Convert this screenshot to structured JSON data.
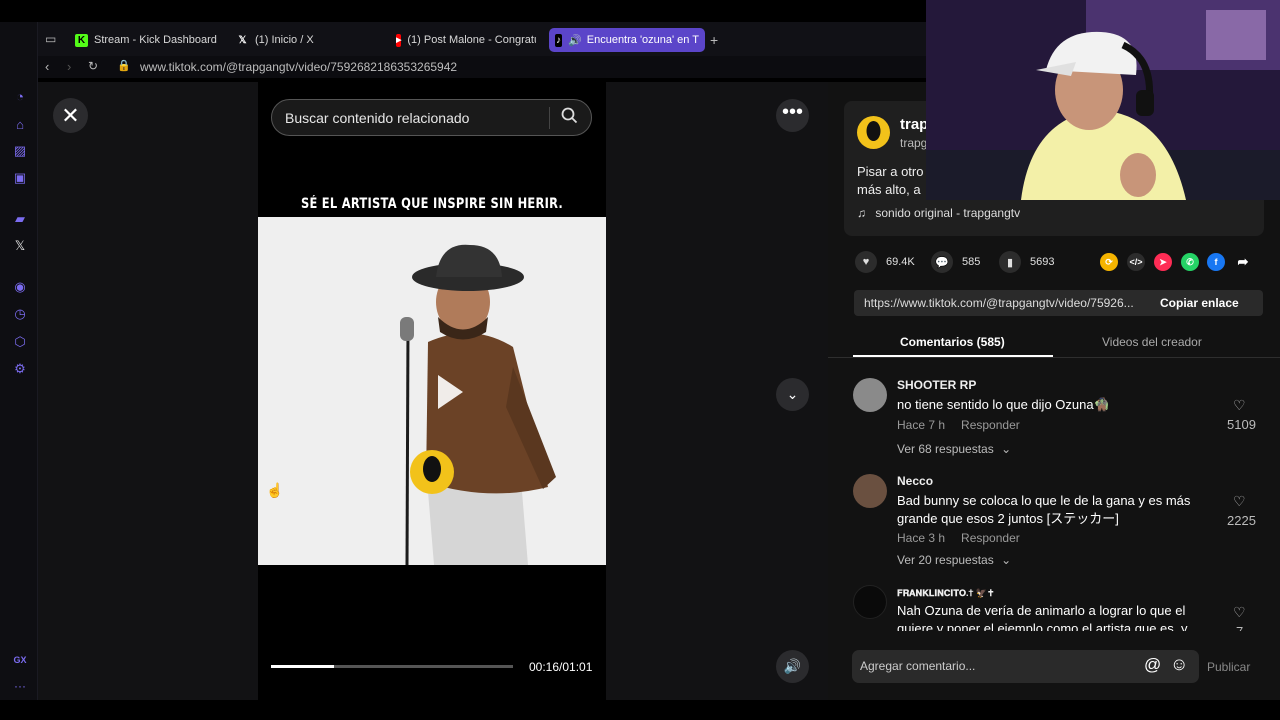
{
  "browser": {
    "tabs": [
      {
        "label": "Stream - Kick Dashboard",
        "icon": "kick-icon"
      },
      {
        "label": "(1) Inicio / X",
        "icon": "x-icon"
      },
      {
        "label": "(1) Post Malone - Congratu",
        "icon": "youtube-icon"
      },
      {
        "label": "Encuentra 'ozuna' en T",
        "icon": "tiktok-icon"
      }
    ],
    "url": "www.tiktok.com/@trapgangtv/video/7592682186353265942"
  },
  "video": {
    "search_placeholder": "Buscar contenido relacionado",
    "caption": "SÉ EL ARTISTA QUE INSPIRE SIN HERIR.",
    "time": "00:16/01:01",
    "progress": 0.26
  },
  "profile": {
    "name": "trap",
    "handle": "trapg",
    "description": "Pisar a otro más alto, a",
    "sound": "sonido original - trapgangtv"
  },
  "stats": {
    "likes": "69.4K",
    "comments": "585",
    "saves": "5693"
  },
  "share": {
    "link": "https://www.tiktok.com/@trapgangtv/video/75926...",
    "copy_label": "Copiar enlace"
  },
  "tabs": {
    "comments": "Comentarios (585)",
    "creator": "Videos del creador"
  },
  "comments": [
    {
      "user": "SHOOTER RP",
      "text": "no tiene sentido lo que dijo Ozuna🧌",
      "time": "Hace 7 h",
      "reply": "Responder",
      "replies": "Ver 68 respuestas",
      "likes": "5109"
    },
    {
      "user": "Necco",
      "text": "Bad bunny se coloca lo que le de la gana y es más grande que esos 2 juntos [ステッカー]",
      "time": "Hace 3 h",
      "reply": "Responder",
      "replies": "Ver 20 respuestas",
      "likes": "2225"
    },
    {
      "user": "𝐅𝐑𝐀𝐍𝐊𝐋𝐈𝐍𝐂𝐈𝐓𝐎.✝ 🦅✝",
      "text": "Nah Ozuna de vería de animarlo a lograr lo que el quiere y poner el ejemplo como el artista que es, y",
      "likes": "7"
    }
  ],
  "composer": {
    "placeholder": "Agregar comentario...",
    "publish": "Publicar"
  },
  "colors": {
    "accent": "#5b45c9",
    "brand_avatar": "#f2c21a"
  }
}
